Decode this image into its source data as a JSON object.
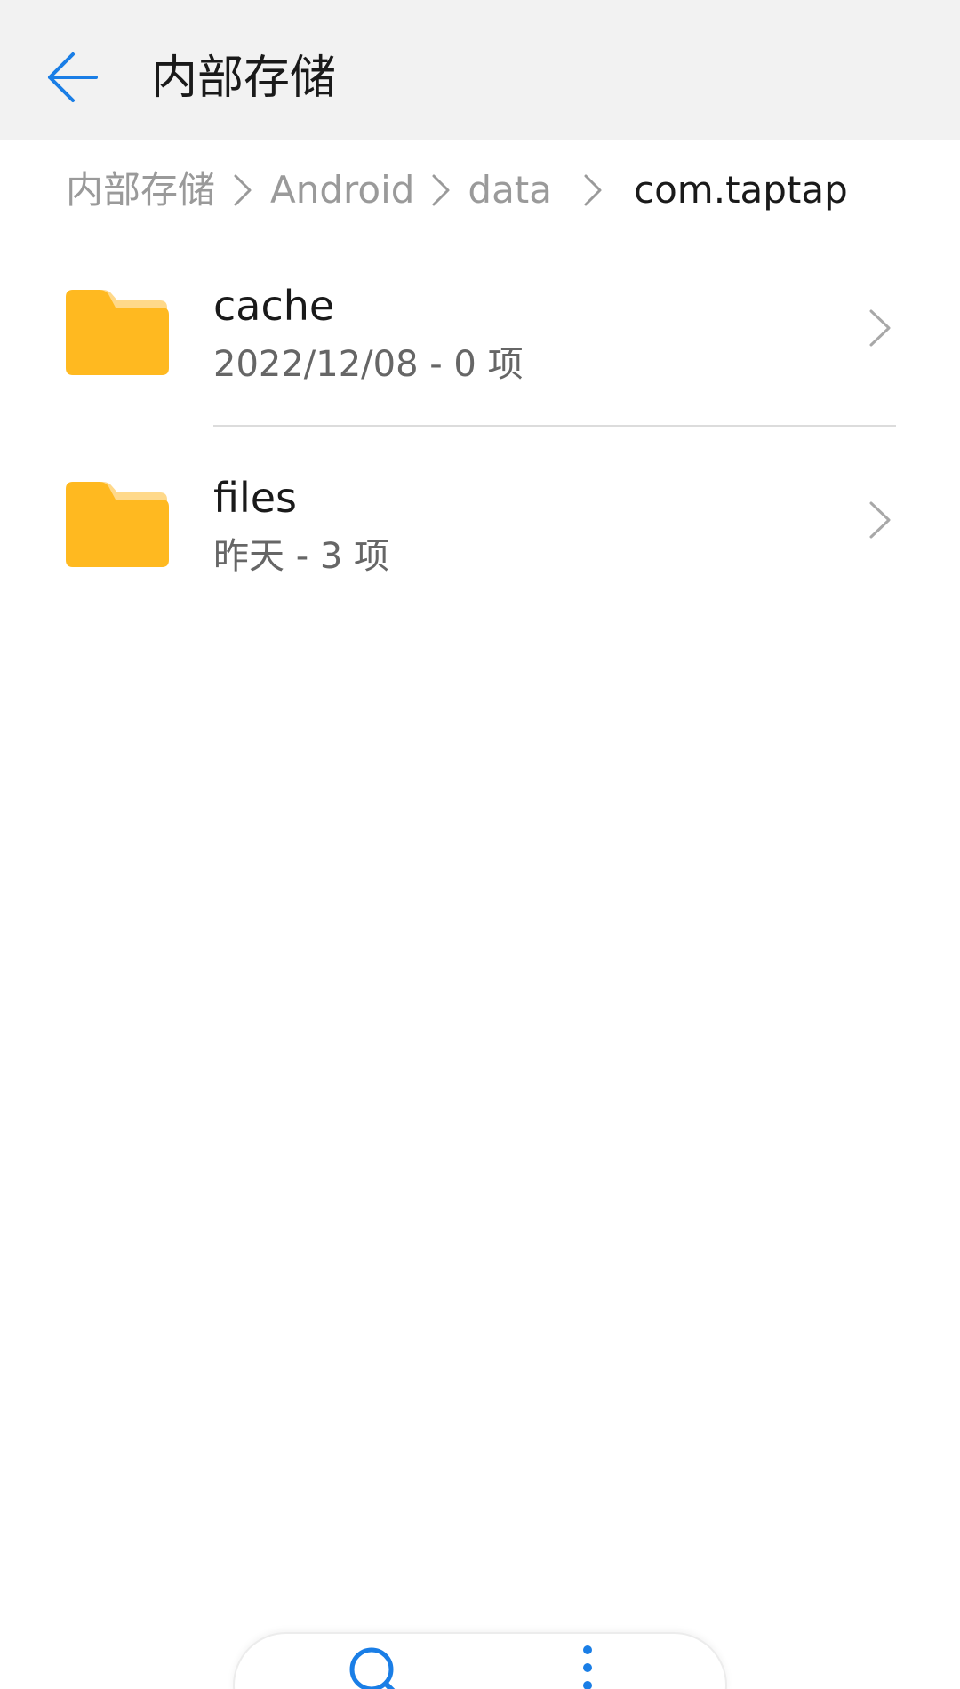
{
  "header": {
    "title": "内部存储",
    "back_icon": "arrow-left-icon"
  },
  "breadcrumb": {
    "items": [
      "内部存储",
      "Android",
      "data",
      "com.taptap"
    ]
  },
  "files": [
    {
      "name": "cache",
      "meta": "2022/12/08 - 0 项",
      "icon": "folder-icon"
    },
    {
      "name": "files",
      "meta": "昨天 - 3 项",
      "icon": "folder-icon"
    }
  ],
  "toolbar": {
    "icons": [
      "search-icon",
      "more-vertical-icon"
    ]
  },
  "colors": {
    "accent": "#1a7ee6",
    "folder": "#ffb920",
    "folder_tab": "#ffd98a",
    "header_bg": "#f2f2f2"
  }
}
